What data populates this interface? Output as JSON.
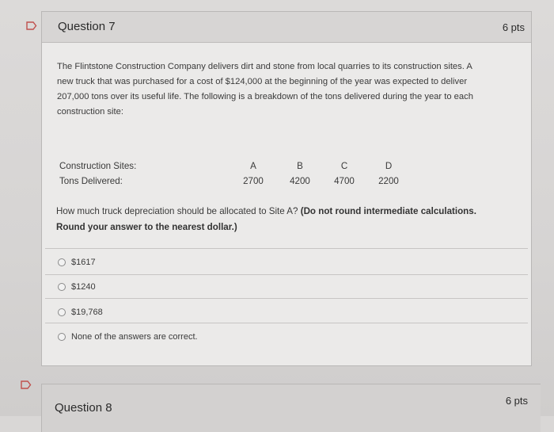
{
  "question7": {
    "title": "Question 7",
    "points": "6 pts",
    "body_lines": [
      "The Flintstone Construction Company delivers dirt and stone from local quarries to its construction sites. A",
      "new truck that was purchased for a cost of $124,000 at the beginning of the year was expected to deliver",
      "207,000 tons over its useful life. The following is a breakdown of the tons delivered during the year to each",
      "construction site:"
    ],
    "table": {
      "row1_label": "Construction Sites:",
      "row2_label": "Tons Delivered:",
      "sites": [
        "A",
        "B",
        "C",
        "D"
      ],
      "tons": [
        "2700",
        "4200",
        "4700",
        "2200"
      ]
    },
    "prompt_normal": "How much truck depreciation should be allocated to Site A? ",
    "prompt_bold_line1": "(Do not round intermediate calculations.",
    "prompt_bold_line2": "Round your answer to the nearest dollar.)",
    "answers": [
      "$1617",
      "$1240",
      "$19,768",
      "None of the answers are correct."
    ]
  },
  "question8": {
    "title": "Question 8",
    "points": "6 pts"
  },
  "icons": {
    "flag": "flag-icon",
    "radio": "radio-button-icon"
  },
  "colors": {
    "flag_red": "#c0504d",
    "background": "#d9d7d6",
    "card": "#ebeae9",
    "header": "#d7d5d4"
  }
}
